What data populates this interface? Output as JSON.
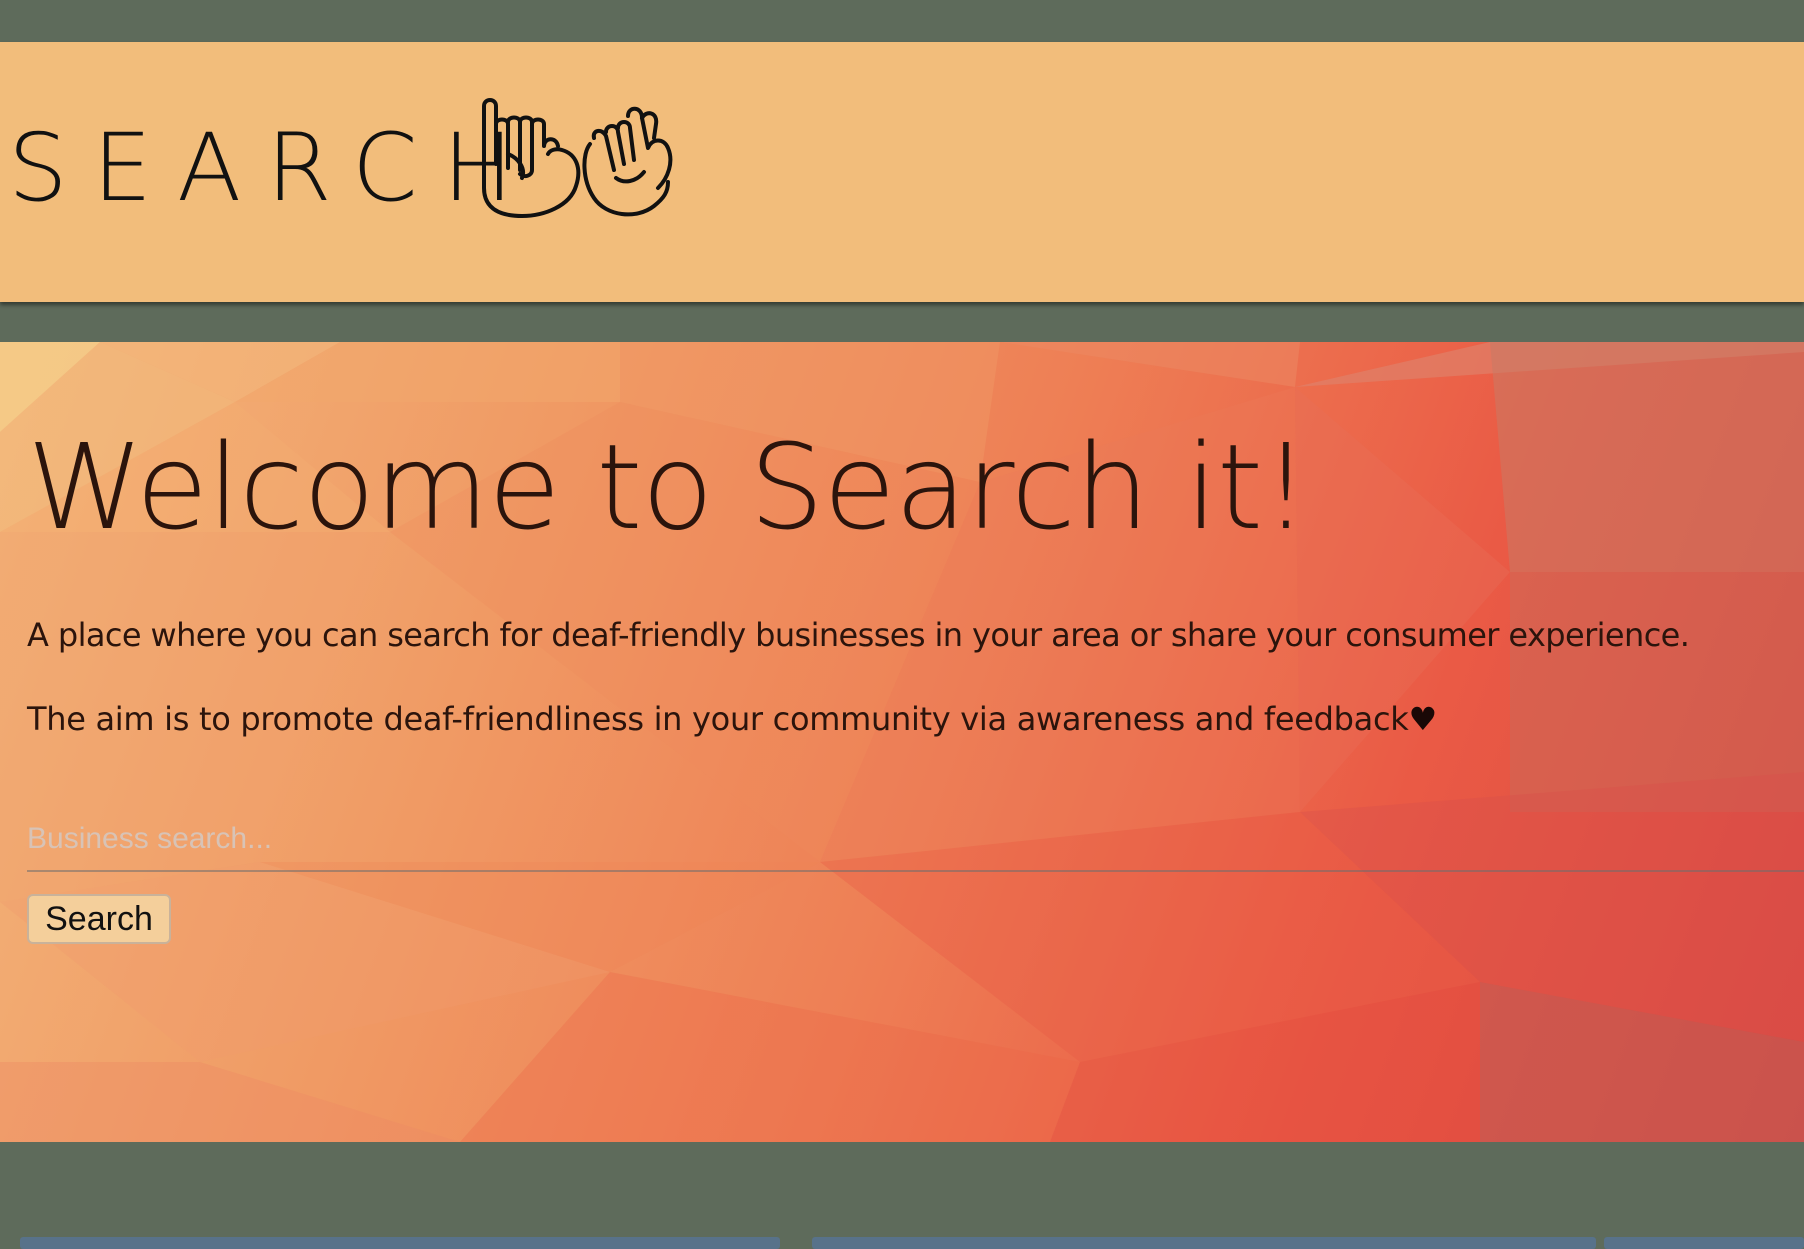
{
  "header": {
    "logo_text": "SEARCH",
    "logo_icon": "sign-language-hands-icon",
    "background_color": "#f2bd7b"
  },
  "hero": {
    "title": "Welcome to Search it!",
    "intro": "A place where you can search for deaf-friendly businesses in your area or share your consumer experience.",
    "aim": "The aim is to promote deaf-friendliness in your community via awareness and feedback",
    "heart": "♥"
  },
  "search": {
    "placeholder": "Business search...",
    "button_label": "Search"
  },
  "colors": {
    "page_background": "#5e6b5b",
    "text": "#2b140c"
  }
}
